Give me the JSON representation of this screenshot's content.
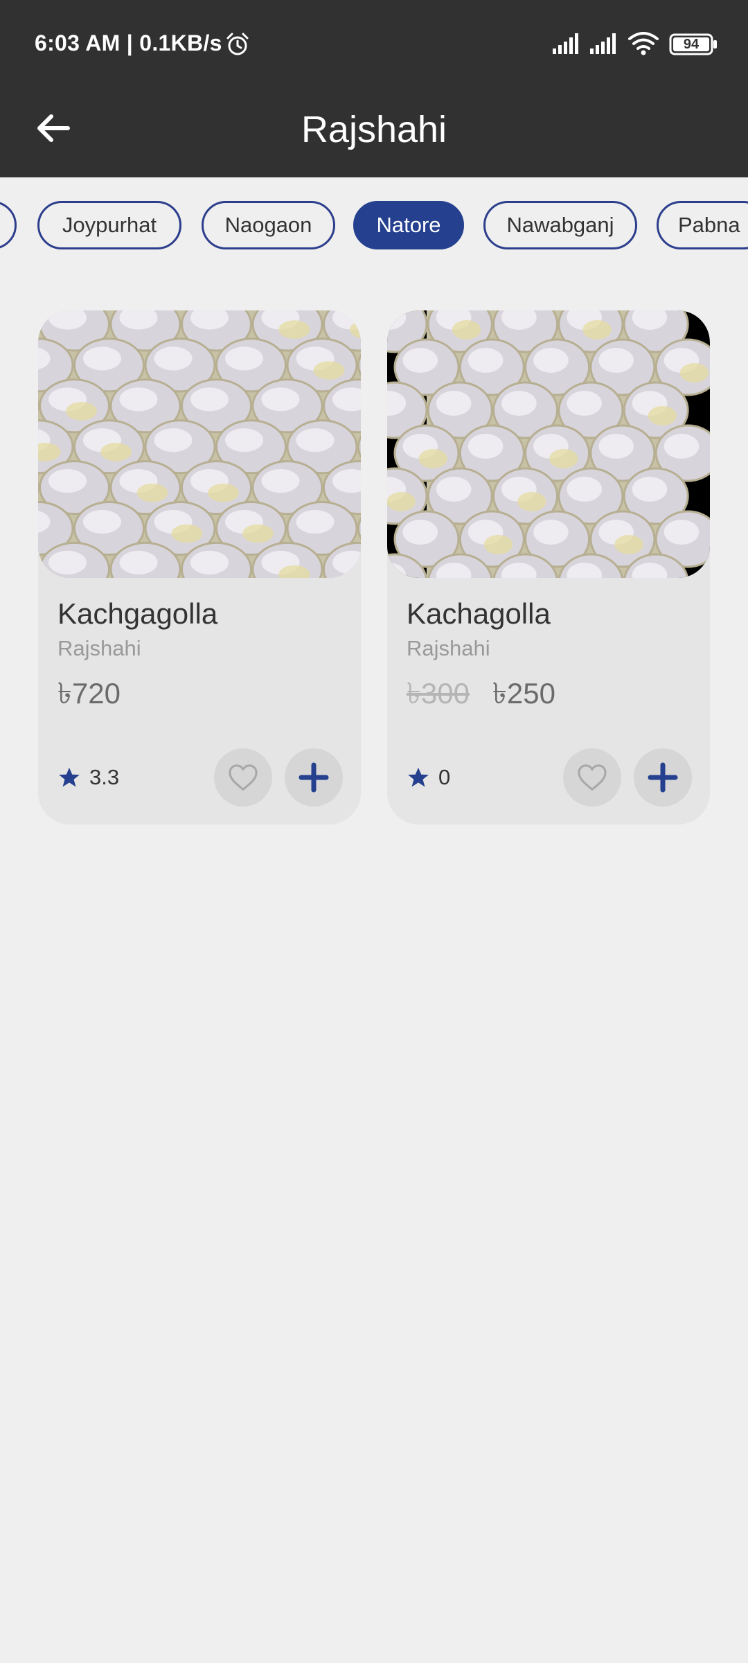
{
  "status_bar": {
    "time_speed": "6:03 AM | 0.1KB/s",
    "battery": "94",
    "icons": [
      "alarm-icon",
      "signal-icon",
      "signal-icon",
      "wifi-icon",
      "battery-icon"
    ]
  },
  "app_bar": {
    "title": "Rajshahi",
    "back_icon": "arrow-left-icon"
  },
  "chips": [
    {
      "label": ""
    },
    {
      "label": "Joypurhat"
    },
    {
      "label": "Naogaon"
    },
    {
      "label": "Natore",
      "selected": true
    },
    {
      "label": "Nawabganj"
    },
    {
      "label": "Pabna"
    }
  ],
  "products": [
    {
      "name": "Kachgagolla",
      "location": "Rajshahi",
      "old_price": "",
      "price": "৳720",
      "rating": "3.3",
      "image": "white-sweets-photo"
    },
    {
      "name": "Kachagolla",
      "location": "Rajshahi",
      "old_price": "৳300",
      "price": "৳250",
      "rating": "0",
      "image": "white-sweets-photo-letterboxed"
    }
  ],
  "colors": {
    "app_bar": "#313131",
    "accent": "#24408e",
    "background": "#efefef",
    "card": "#e5e5e5"
  }
}
